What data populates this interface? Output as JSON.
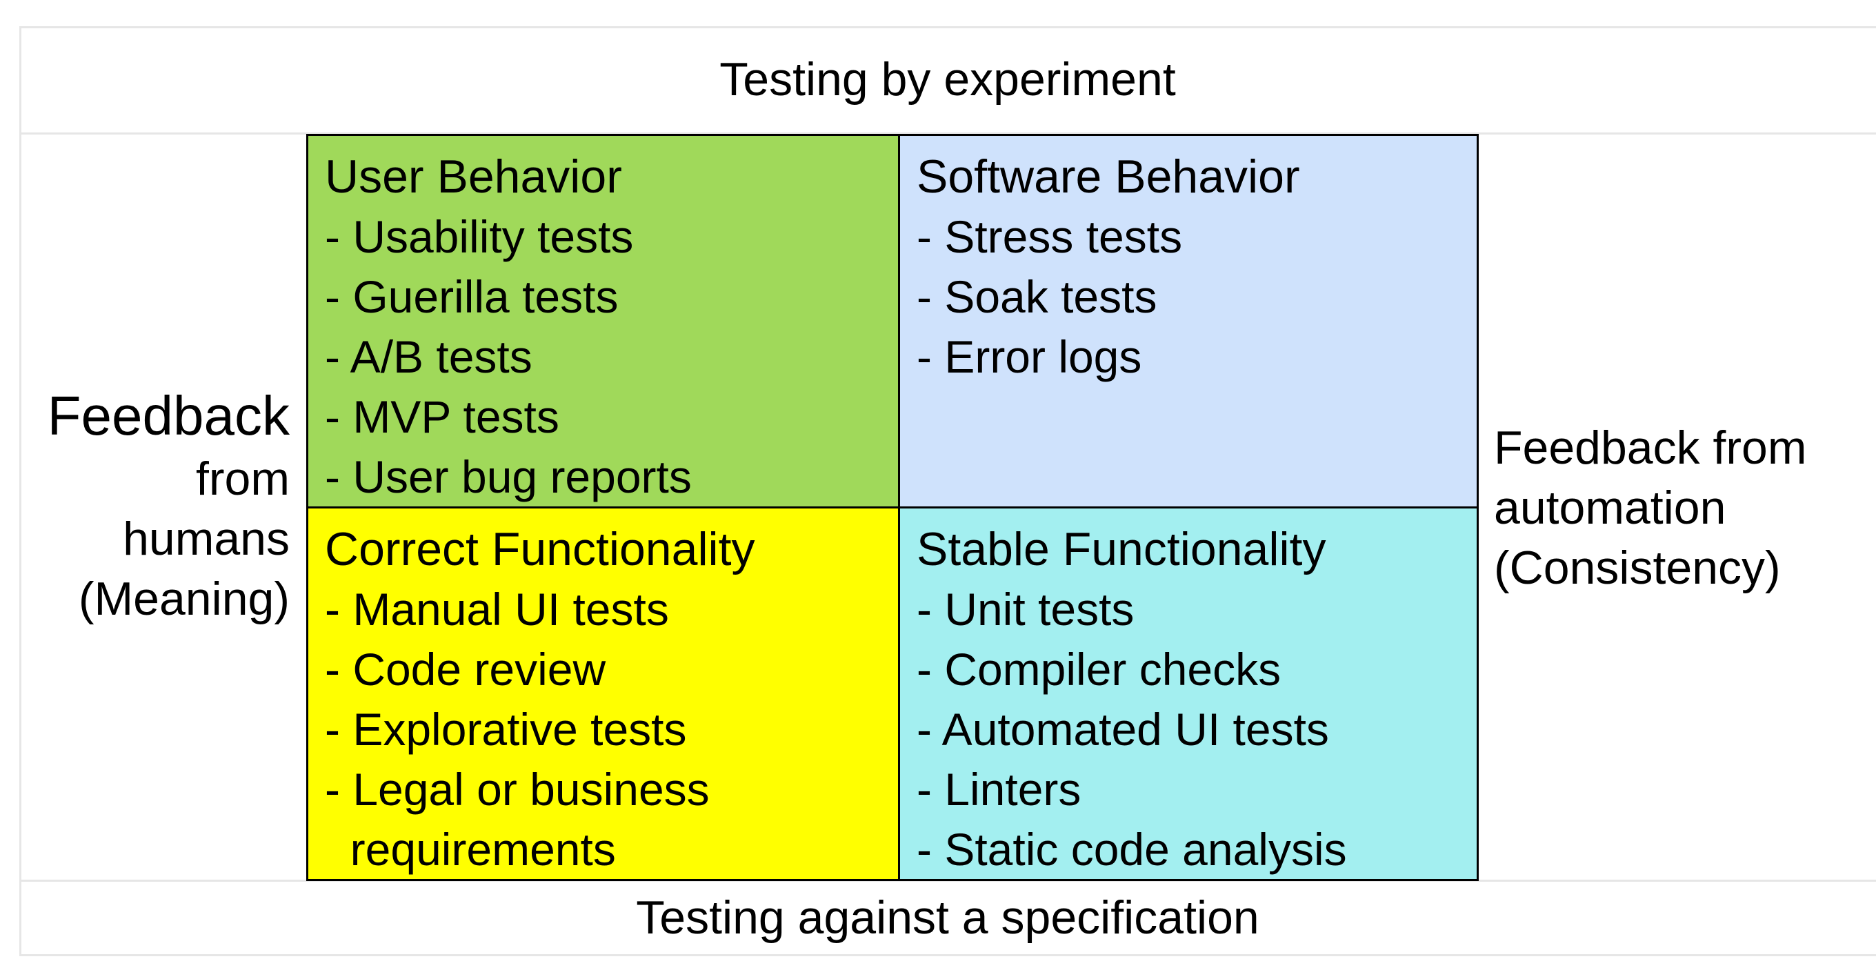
{
  "top_label": "Testing by experiment",
  "bottom_label": "Testing against a specification",
  "left_label": [
    "Feedback",
    "from",
    "humans",
    "(Meaning)"
  ],
  "right_label": [
    "Feedback from",
    "automation",
    "(Consistency)"
  ],
  "colors": {
    "user_behavior": "#a0d95a",
    "software_behavior": "#cfe2fc",
    "correct_functionality": "#ffff00",
    "stable_functionality": "#a3eff0",
    "grid_border": "#000000",
    "outer_border": "#e6e6e6"
  },
  "quadrants": [
    {
      "title": "User Behavior",
      "items": [
        "- Usability tests",
        "- Guerilla tests",
        "- A/B tests",
        "- MVP tests",
        "- User bug reports"
      ]
    },
    {
      "title": "Software Behavior",
      "items": [
        "- Stress tests",
        "- Soak tests",
        "- Error logs"
      ]
    },
    {
      "title": "Correct Functionality",
      "items": [
        "- Manual UI tests",
        "- Code review",
        "- Explorative tests",
        "- Legal or business",
        "  requirements"
      ]
    },
    {
      "title": "Stable Functionality",
      "items": [
        "- Unit tests",
        "- Compiler checks",
        "- Automated UI tests",
        "- Linters",
        "- Static code analysis"
      ]
    }
  ]
}
